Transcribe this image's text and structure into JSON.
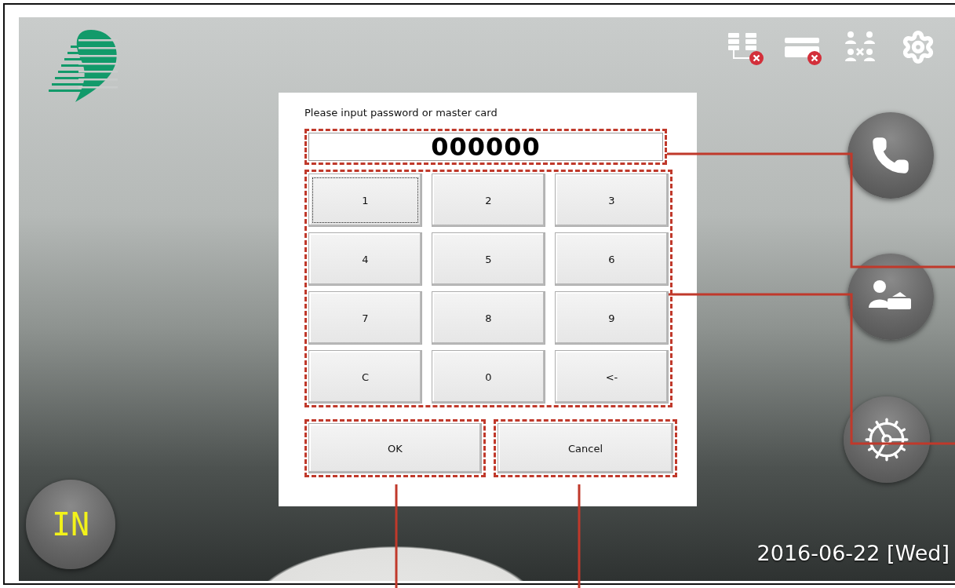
{
  "dialog": {
    "prompt": "Please input password or master card",
    "display": "000000",
    "keys": [
      {
        "label": "1",
        "focused": true
      },
      {
        "label": "2",
        "focused": false
      },
      {
        "label": "3",
        "focused": false
      },
      {
        "label": "4",
        "focused": false
      },
      {
        "label": "5",
        "focused": false
      },
      {
        "label": "6",
        "focused": false
      },
      {
        "label": "7",
        "focused": false
      },
      {
        "label": "8",
        "focused": false
      },
      {
        "label": "9",
        "focused": false
      },
      {
        "label": "C",
        "focused": false
      },
      {
        "label": "0",
        "focused": false
      },
      {
        "label": "<-",
        "focused": false
      }
    ],
    "actions": [
      "OK",
      "Cancel"
    ]
  },
  "status_badge": "IN",
  "date": "2016-06-22 [Wed]"
}
